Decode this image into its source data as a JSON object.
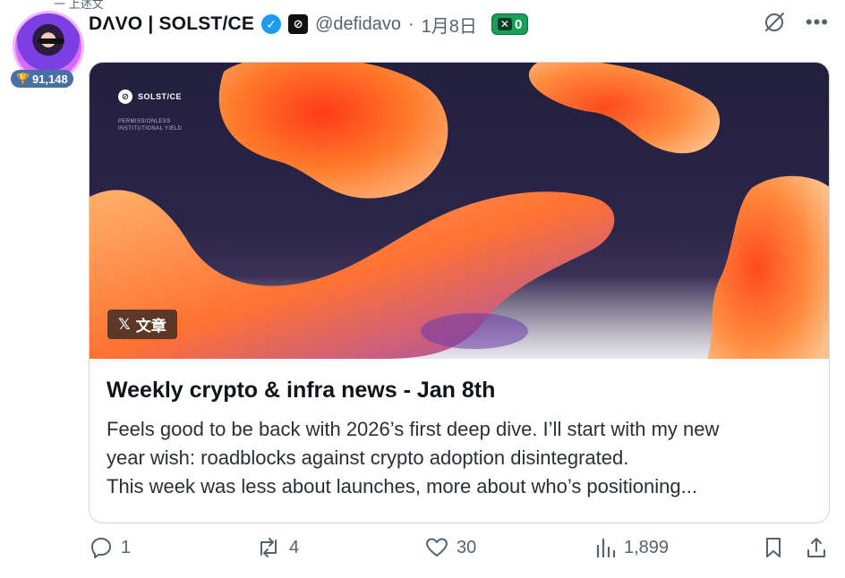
{
  "top_clip_text": "一 上述文",
  "author": {
    "display_name": "DΛVO | SOLST/CE",
    "handle": "@defidavo",
    "separator": "·",
    "date": "1月8日",
    "follower_badge": "91,148",
    "x_pill_count": "0"
  },
  "article": {
    "brand": "SOLST/CE",
    "tagline": "PERMISSIONLESS INSTITUTIONAL YIELD",
    "tag_x": "𝕏",
    "tag_label": "文章",
    "title": "Weekly crypto & infra news - Jan 8th",
    "description_lines": [
      "Feels good to be back with 2026’s first deep dive. I’ll start with my new",
      "year wish: roadblocks against crypto adoption disintegrated.",
      "This week was less about launches, more about who’s positioning..."
    ]
  },
  "actions": {
    "replies": "1",
    "reposts": "4",
    "likes": "30",
    "views": "1,899"
  },
  "colors": {
    "accent": "#1d9bf0",
    "muted_text": "#536471",
    "hero_bg": "#231f3e",
    "blob_orange": "#ff7a2a",
    "pill_green": "#18a058"
  }
}
